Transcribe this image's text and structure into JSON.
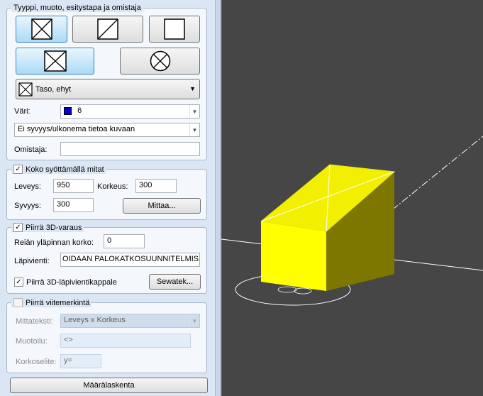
{
  "type_group": {
    "title": "Tyyppi, muoto, esitystapa ja omistaja",
    "style_select": {
      "value": "Taso, ehyt"
    }
  },
  "color": {
    "label": "Väri:",
    "value": "6",
    "swatch": "#0000c8"
  },
  "depth_select": {
    "value": "Ei syvyys/ulkonema tietoa kuvaan"
  },
  "owner": {
    "label": "Omistaja:",
    "value": ""
  },
  "size_group": {
    "title": "Koko syöttämällä mitat",
    "checked": true,
    "width_label": "Leveys:",
    "width_value": "950",
    "height_label": "Korkeus:",
    "height_value": "300",
    "depth_label": "Syvyys:",
    "depth_value": "300",
    "measure_button": "Mittaa..."
  },
  "reserve_group": {
    "title": "Piirrä 3D-varaus",
    "checked": true,
    "top_label": "Reiän yläpinnan korko:",
    "top_value": "0",
    "penetration_label": "Läpivienti:",
    "penetration_value": "OIDAAN PALOKATKOSUUNNITELMISSA",
    "draw_piece_label": "Piirrä 3D-läpivientikappale",
    "draw_piece_checked": true,
    "sewatek_button": "Sewatek..."
  },
  "dim_group": {
    "title": "Piirrä viitemerkintä",
    "checked": false,
    "text_label": "Mittateksti:",
    "text_value": "Leveys x Korkeus",
    "format_label": "Muotoilu:",
    "format_value": "<>",
    "level_label": "Korkoselite:",
    "level_value": "y="
  },
  "quantity_button": "Määrälaskenta"
}
